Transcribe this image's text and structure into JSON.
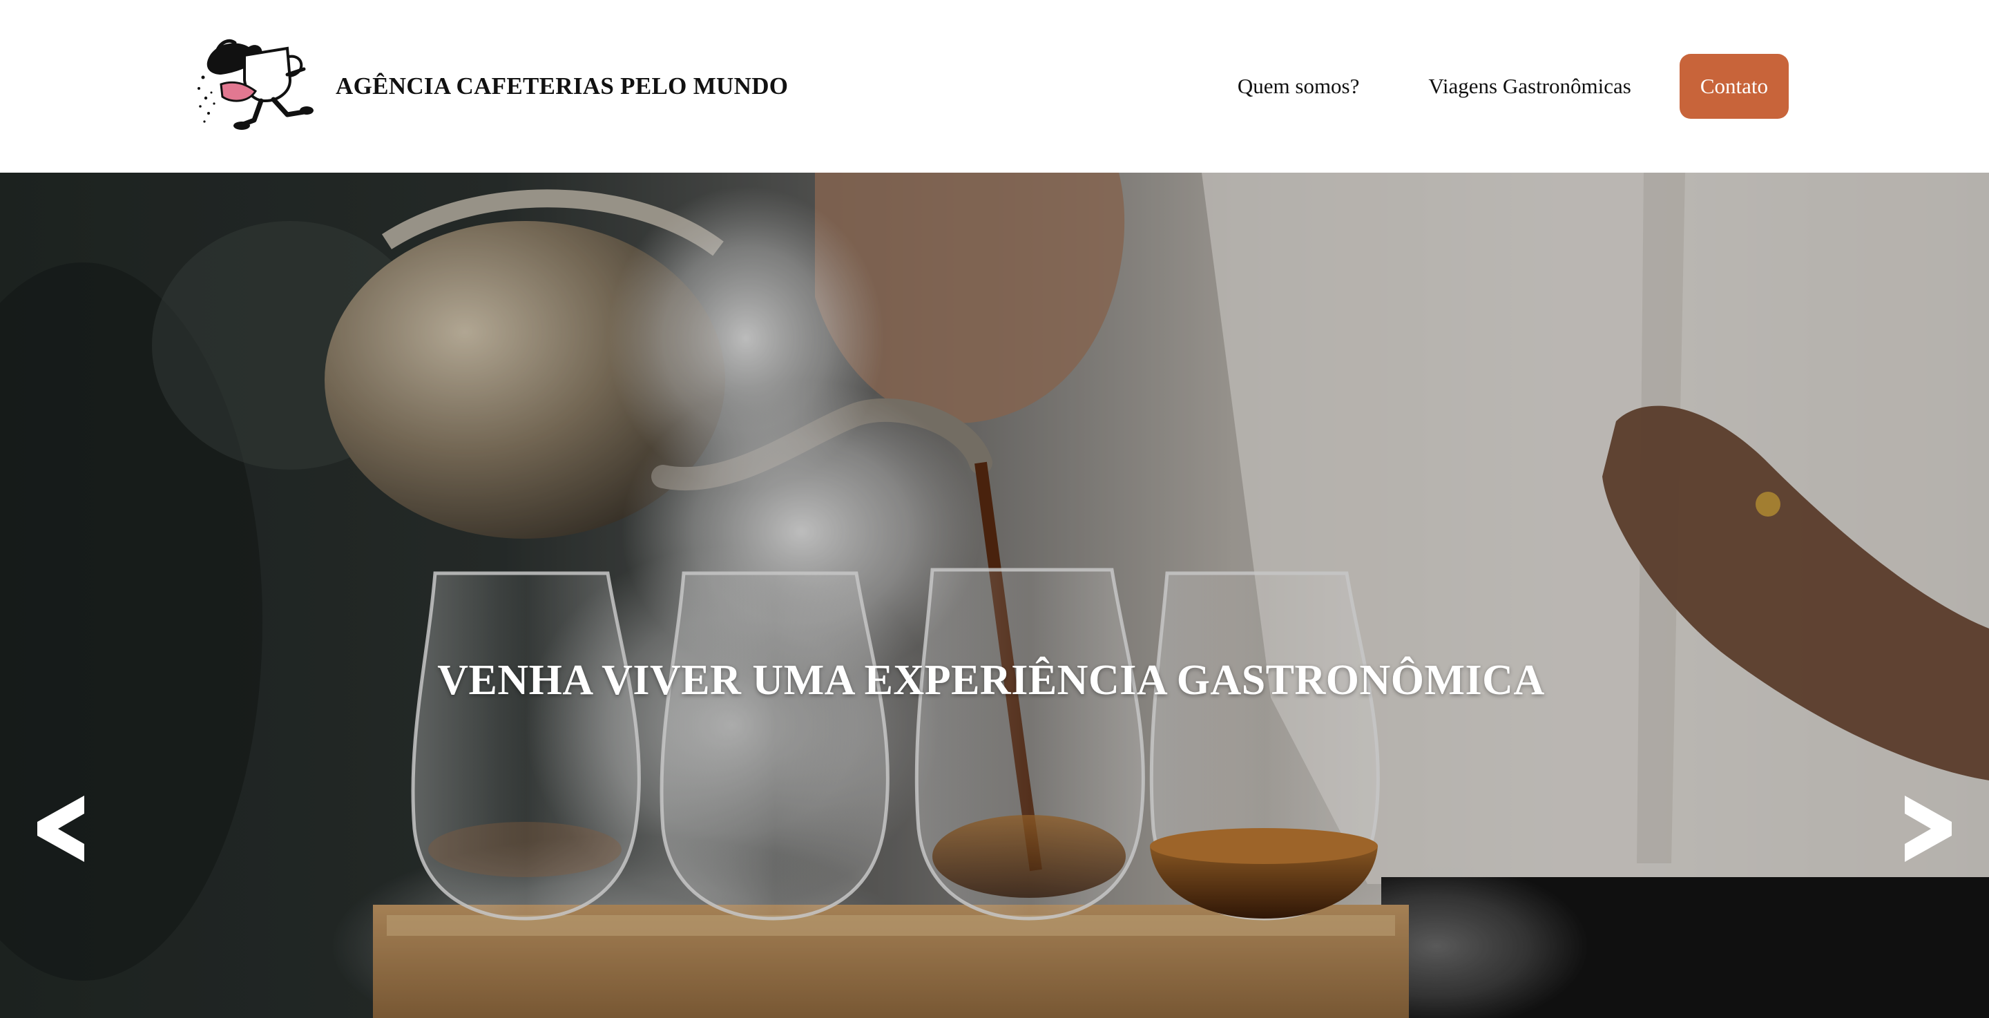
{
  "header": {
    "brand_name": "AGÊNCIA CAFETERIAS PELO MUNDO",
    "logo_icon": "coffee-cup-mascot-icon",
    "nav": [
      {
        "label": "Quem somos?"
      },
      {
        "label": "Viagens Gastronômicas"
      }
    ],
    "contact_label": "Contato"
  },
  "hero": {
    "title": "VENHA VIVER UMA EXPERIÊNCIA GASTRONÔMICA",
    "image": "coffee-pour-photo",
    "prev_icon": "chevron-left-icon",
    "next_icon": "chevron-right-icon"
  },
  "colors": {
    "accent": "#c8643a",
    "header_bg": "#ffffff",
    "text": "#111111",
    "hero_text": "#ffffff"
  }
}
